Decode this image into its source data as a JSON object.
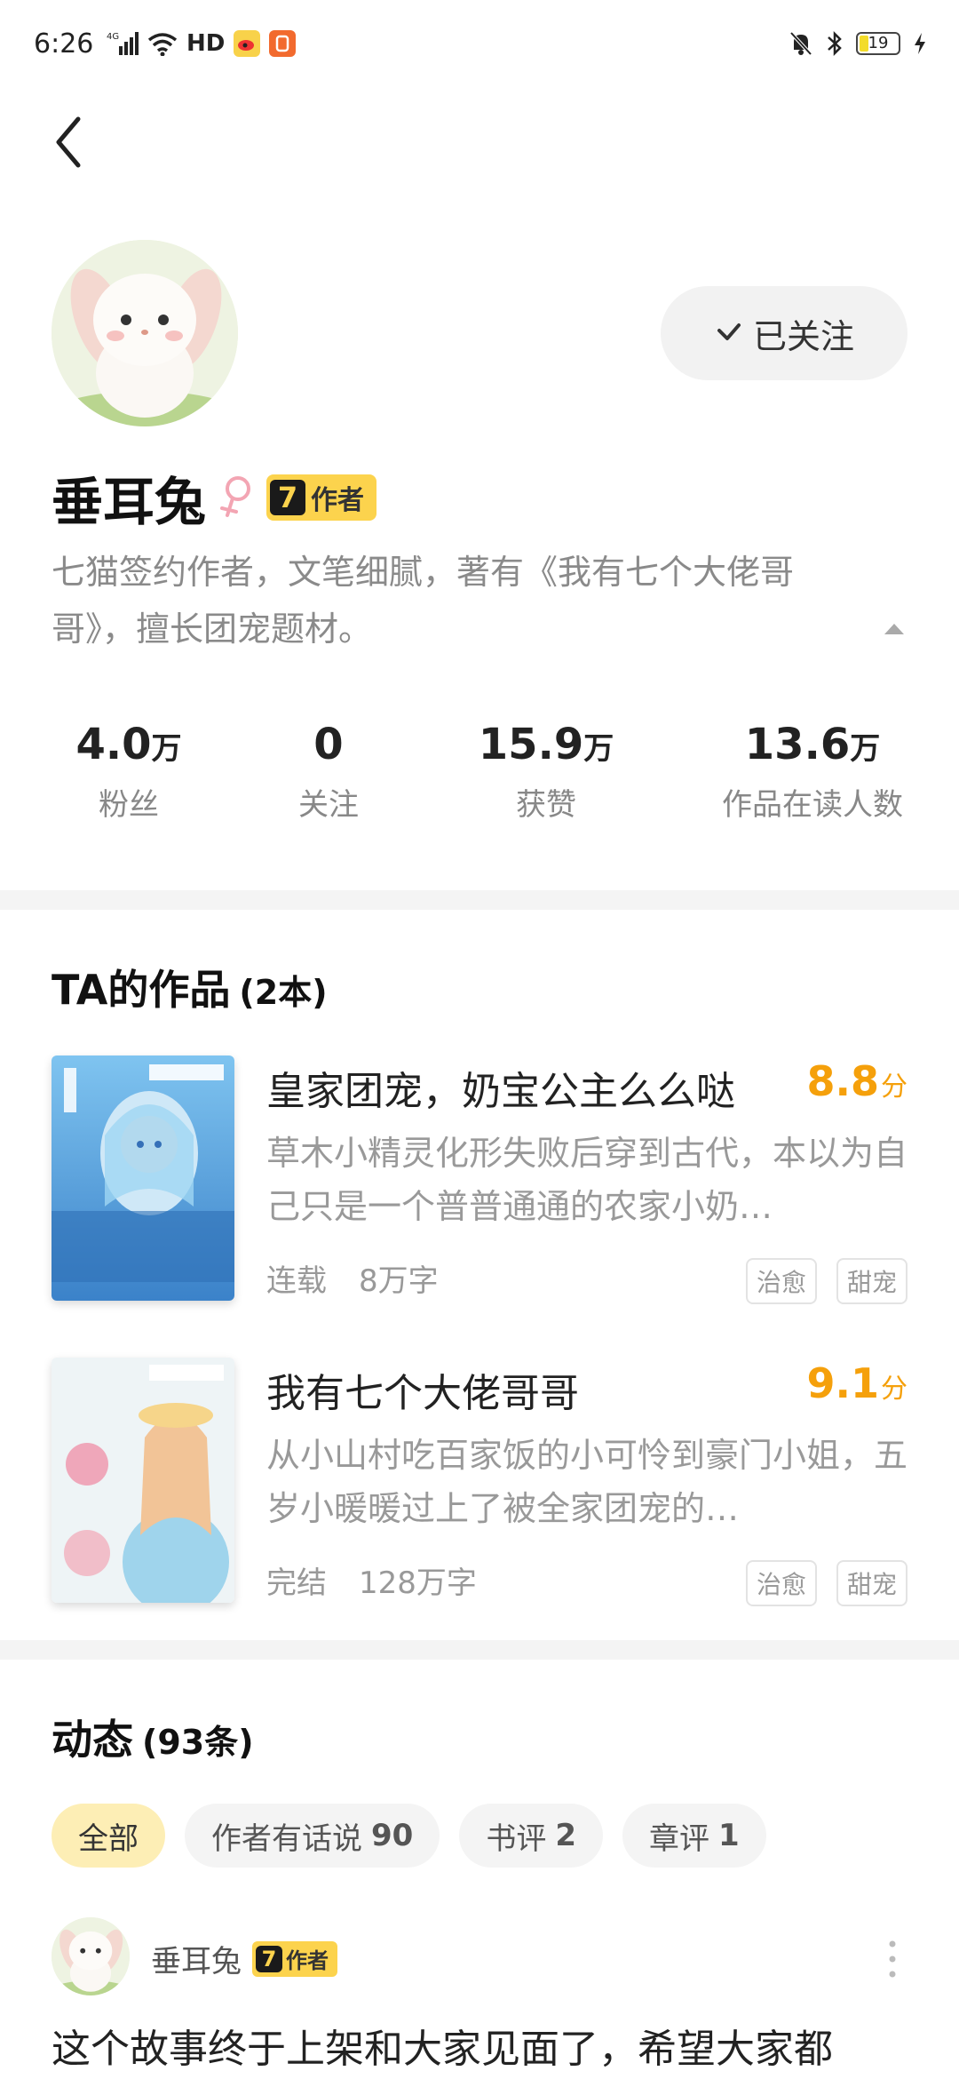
{
  "status_bar": {
    "time": "6:26",
    "network": "4G",
    "hd": "HD",
    "battery": "19"
  },
  "author": {
    "name": "垂耳兔",
    "badge": "作者",
    "badge_icon": "7",
    "follow_label": "已关注",
    "bio": "七猫签约作者，文笔细腻，著有《我有七个大佬哥哥》，擅长团宠题材。"
  },
  "stats": [
    {
      "value": "4.0",
      "unit": "万",
      "label": "粉丝"
    },
    {
      "value": "0",
      "unit": "",
      "label": "关注"
    },
    {
      "value": "15.9",
      "unit": "万",
      "label": "获赞"
    },
    {
      "value": "13.6",
      "unit": "万",
      "label": "作品在读人数"
    }
  ],
  "works": {
    "title": "TA的作品",
    "count": "(2本)",
    "books": [
      {
        "title": "皇家团宠，奶宝公主么么哒",
        "score": "8.8",
        "score_unit": "分",
        "desc": "草木小精灵化形失败后穿到古代，本以为自己只是一个普普通通的农家小奶…",
        "status": "连载",
        "words": "8万字",
        "tags": [
          "治愈",
          "甜宠"
        ]
      },
      {
        "title": "我有七个大佬哥哥",
        "score": "9.1",
        "score_unit": "分",
        "desc": "从小山村吃百家饭的小可怜到豪门小姐，五岁小暖暖过上了被全家团宠的…",
        "status": "完结",
        "words": "128万字",
        "tags": [
          "治愈",
          "甜宠"
        ]
      }
    ]
  },
  "feed": {
    "title": "动态",
    "count": "(93条)",
    "filters": [
      {
        "label": "全部",
        "count": ""
      },
      {
        "label": "作者有话说",
        "count": "90"
      },
      {
        "label": "书评",
        "count": "2"
      },
      {
        "label": "章评",
        "count": "1"
      }
    ],
    "post": {
      "author": "垂耳兔",
      "badge": "作者",
      "text": "这个故事终于上架和大家见面了，希望大家都"
    }
  },
  "colors": {
    "accent_yellow": "#fcd34d",
    "score_orange": "#f5a00b",
    "chip_active": "#fdeeb5"
  }
}
